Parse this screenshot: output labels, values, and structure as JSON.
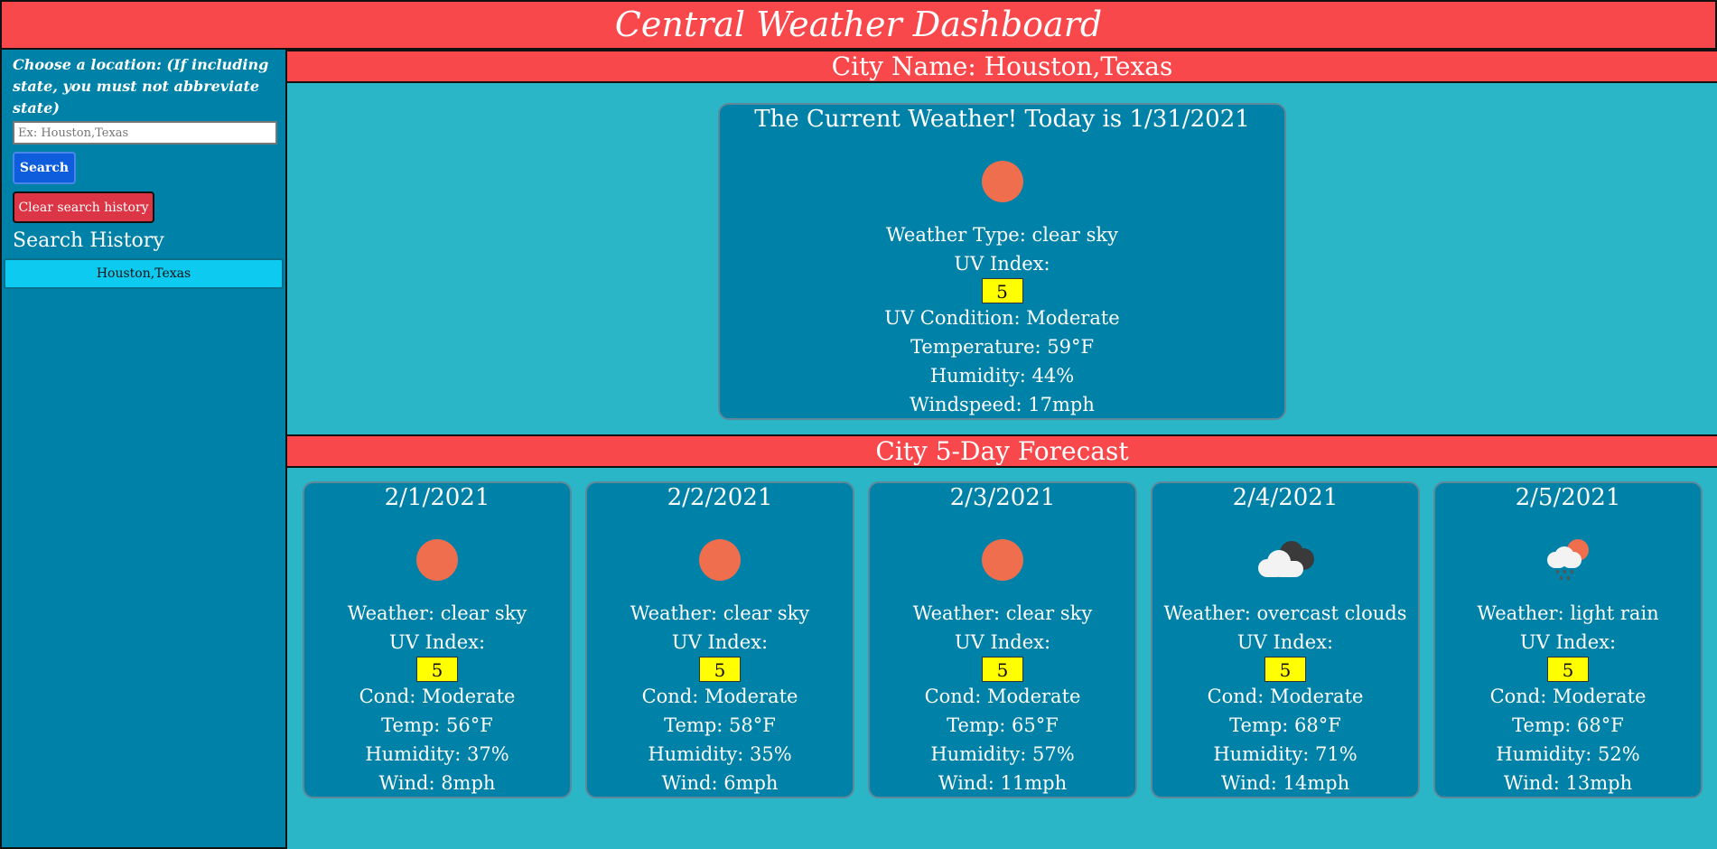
{
  "header": {
    "title": "Central Weather Dashboard"
  },
  "sidebar": {
    "prompt": "Choose a location: (If including state, you must not abbreviate state)",
    "search_input": {
      "placeholder": "Ex: Houston,Texas",
      "value": ""
    },
    "search_button": "Search",
    "clear_button": "Clear search history",
    "history_title": "Search History",
    "history": [
      "Houston,Texas"
    ]
  },
  "city_bar": {
    "label": "City Name: Houston,Texas"
  },
  "current": {
    "title": "The Current Weather! Today is 1/31/2021",
    "icon": "sun-icon",
    "weather_type": "Weather Type: clear sky",
    "uv_label": "UV Index:",
    "uv_value": "5",
    "uv_condition": "UV Condition: Moderate",
    "temperature": "Temperature: 59°F",
    "humidity": "Humidity: 44%",
    "windspeed": "Windspeed: 17mph"
  },
  "forecast_bar": {
    "label": "City 5-Day Forecast"
  },
  "forecast": [
    {
      "date": "2/1/2021",
      "icon": "sun-icon",
      "weather": "Weather: clear sky",
      "uv_label": "UV Index:",
      "uv_value": "5",
      "cond": "Cond: Moderate",
      "temp": "Temp: 56°F",
      "humidity": "Humidity: 37%",
      "wind": "Wind: 8mph"
    },
    {
      "date": "2/2/2021",
      "icon": "sun-icon",
      "weather": "Weather: clear sky",
      "uv_label": "UV Index:",
      "uv_value": "5",
      "cond": "Cond: Moderate",
      "temp": "Temp: 58°F",
      "humidity": "Humidity: 35%",
      "wind": "Wind: 6mph"
    },
    {
      "date": "2/3/2021",
      "icon": "sun-icon",
      "weather": "Weather: clear sky",
      "uv_label": "UV Index:",
      "uv_value": "5",
      "cond": "Cond: Moderate",
      "temp": "Temp: 65°F",
      "humidity": "Humidity: 57%",
      "wind": "Wind: 11mph"
    },
    {
      "date": "2/4/2021",
      "icon": "cloud-icon",
      "weather": "Weather: overcast clouds",
      "uv_label": "UV Index:",
      "uv_value": "5",
      "cond": "Cond: Moderate",
      "temp": "Temp: 68°F",
      "humidity": "Humidity: 71%",
      "wind": "Wind: 14mph"
    },
    {
      "date": "2/5/2021",
      "icon": "rain-icon",
      "weather": "Weather: light rain",
      "uv_label": "UV Index:",
      "uv_value": "5",
      "cond": "Cond: Moderate",
      "temp": "Temp: 68°F",
      "humidity": "Humidity: 52%",
      "wind": "Wind: 13mph"
    }
  ],
  "colors": {
    "header_red": "#f9484b",
    "sidebar_blue": "#0081a8",
    "page_teal": "#2bb6c8",
    "uv_yellow": "#ffff00",
    "sun_orange": "#ee6e4d",
    "search_button_blue": "#0d5ddc",
    "clear_button_red": "#dc3545",
    "history_item_cyan": "#0dcaf0"
  }
}
